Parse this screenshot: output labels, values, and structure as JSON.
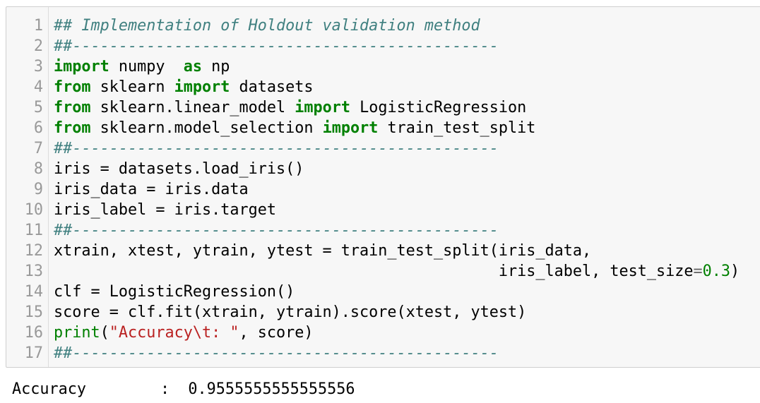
{
  "cell": {
    "lines": [
      {
        "n": "1",
        "parts": [
          {
            "t": "## Implementation of Holdout validation method",
            "c": "cm"
          }
        ]
      },
      {
        "n": "2",
        "parts": [
          {
            "t": "##----------------------------------------------",
            "c": "cm"
          }
        ]
      },
      {
        "n": "3",
        "parts": [
          {
            "t": "import",
            "c": "kw"
          },
          {
            "t": " numpy  ",
            "c": ""
          },
          {
            "t": "as",
            "c": "kw"
          },
          {
            "t": " np",
            "c": ""
          }
        ]
      },
      {
        "n": "4",
        "parts": [
          {
            "t": "from",
            "c": "kw"
          },
          {
            "t": " sklearn ",
            "c": ""
          },
          {
            "t": "import",
            "c": "kw"
          },
          {
            "t": " datasets",
            "c": ""
          }
        ]
      },
      {
        "n": "5",
        "parts": [
          {
            "t": "from",
            "c": "kw"
          },
          {
            "t": " sklearn.linear_model ",
            "c": ""
          },
          {
            "t": "import",
            "c": "kw"
          },
          {
            "t": " LogisticRegression",
            "c": ""
          }
        ]
      },
      {
        "n": "6",
        "parts": [
          {
            "t": "from",
            "c": "kw"
          },
          {
            "t": " sklearn.model_selection ",
            "c": ""
          },
          {
            "t": "import",
            "c": "kw"
          },
          {
            "t": " train_test_split",
            "c": ""
          }
        ]
      },
      {
        "n": "7",
        "parts": [
          {
            "t": "##----------------------------------------------",
            "c": "cm"
          }
        ]
      },
      {
        "n": "8",
        "parts": [
          {
            "t": "iris = datasets.load_iris()",
            "c": ""
          }
        ]
      },
      {
        "n": "9",
        "parts": [
          {
            "t": "iris_data = iris.data",
            "c": ""
          }
        ]
      },
      {
        "n": "10",
        "parts": [
          {
            "t": "iris_label = iris.target",
            "c": ""
          }
        ]
      },
      {
        "n": "11",
        "parts": [
          {
            "t": "##----------------------------------------------",
            "c": "cm"
          }
        ]
      },
      {
        "n": "12",
        "parts": [
          {
            "t": "xtrain, xtest, ytrain, ytest = train_test_split(iris_data,",
            "c": ""
          }
        ]
      },
      {
        "n": "13",
        "parts": [
          {
            "t": "                                                iris_label, test_size",
            "c": ""
          },
          {
            "t": "=",
            "c": "op"
          },
          {
            "t": "0.3",
            "c": "num"
          },
          {
            "t": ")",
            "c": ""
          }
        ]
      },
      {
        "n": "14",
        "parts": [
          {
            "t": "clf = LogisticRegression()",
            "c": ""
          }
        ]
      },
      {
        "n": "15",
        "parts": [
          {
            "t": "score = clf.fit(xtrain, ytrain).score(xtest, ytest)",
            "c": ""
          }
        ]
      },
      {
        "n": "16",
        "parts": [
          {
            "t": "print",
            "c": "nb"
          },
          {
            "t": "(",
            "c": ""
          },
          {
            "t": "\"Accuracy\\t: \"",
            "c": "st"
          },
          {
            "t": ", score)",
            "c": ""
          }
        ]
      },
      {
        "n": "17",
        "parts": [
          {
            "t": "##----------------------------------------------",
            "c": "cm"
          }
        ]
      }
    ]
  },
  "output": {
    "text": "Accuracy        :  0.9555555555555556"
  }
}
